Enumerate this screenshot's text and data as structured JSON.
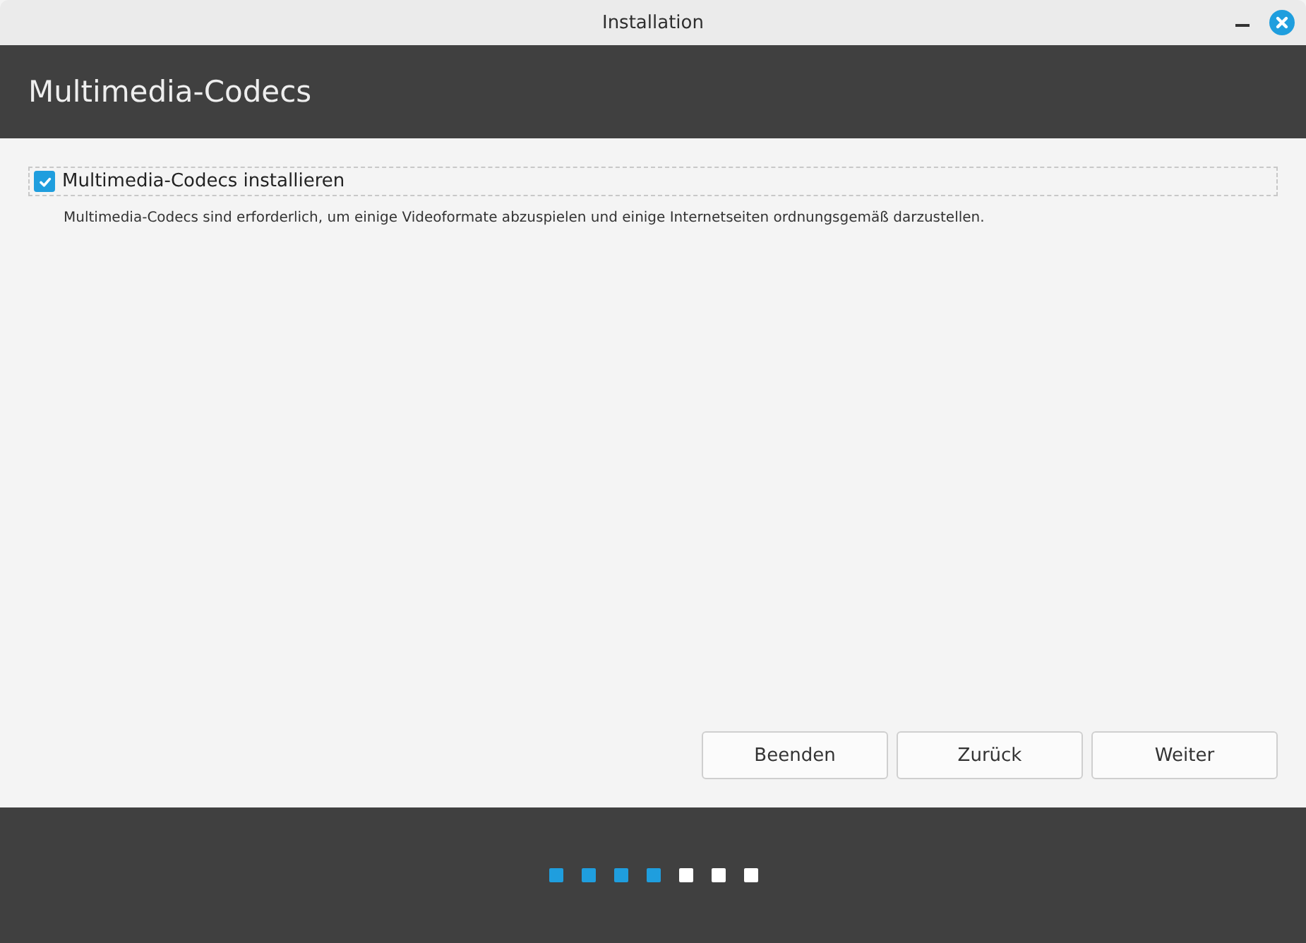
{
  "window": {
    "title": "Installation"
  },
  "header": {
    "title": "Multimedia-Codecs"
  },
  "option": {
    "label": "Multimedia-Codecs installieren",
    "checked": true,
    "description": "Multimedia-Codecs sind erforderlich, um einige Videoformate abzuspielen und einige Internetseiten ordnungsgemäß darzustellen."
  },
  "buttons": [
    {
      "label": "Beenden"
    },
    {
      "label": "Zurück"
    },
    {
      "label": "Weiter"
    }
  ],
  "progress_steps": [
    {
      "done": true
    },
    {
      "done": true
    },
    {
      "done": true
    },
    {
      "done": true
    },
    {
      "done": false
    },
    {
      "done": false
    },
    {
      "done": false
    }
  ]
}
